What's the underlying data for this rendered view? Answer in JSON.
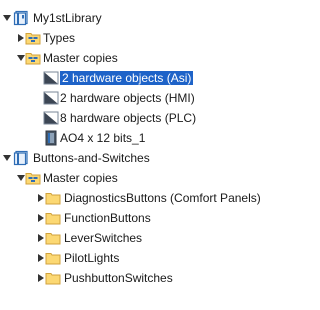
{
  "tree": {
    "library_name": "My1stLibrary",
    "types_label": "Types",
    "master_copies_label": "Master copies",
    "items": [
      "2 hardware objects (Asi)",
      "2 hardware objects (HMI)",
      "8 hardware objects (PLC)",
      "AO4 x 12 bits_1"
    ],
    "library2_name": "Buttons-and-Switches",
    "master_copies2_label": "Master copies",
    "folders": [
      "DiagnosticsButtons (Comfort Panels)",
      "FunctionButtons",
      "LeverSwitches",
      "PilotLights",
      "PushbuttonSwitches"
    ]
  },
  "colors": {
    "selection": "#1e63c8",
    "folder_fill": "#fcd873",
    "folder_edge": "#d1a23c",
    "library_blue": "#2f6db5",
    "arrow": "#333333"
  }
}
